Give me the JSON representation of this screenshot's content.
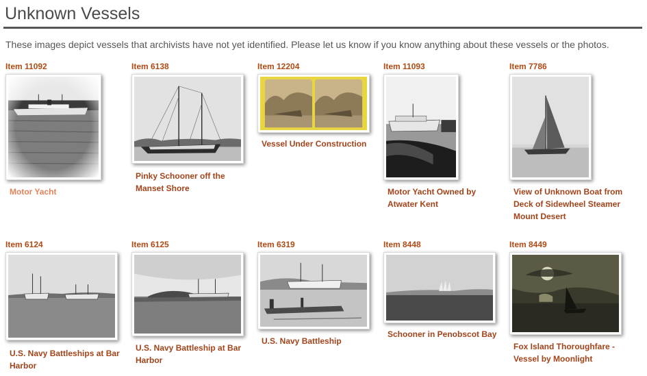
{
  "page": {
    "title": "Unknown Vessels",
    "intro": "These images depict vessels that archivists have not yet identified. Please let us know if you know anything about these vessels or the photos."
  },
  "colors": {
    "link": "#a3431a",
    "link_hover": "#e2825a",
    "rule": "#555555"
  },
  "items": [
    {
      "id": "Item 11092",
      "caption": "Motor Yacht",
      "image": "motor-yacht-photo"
    },
    {
      "id": "Item 6138",
      "caption": "Pinky Schooner off the Manset Shore",
      "image": "pinky-schooner-photo"
    },
    {
      "id": "Item 12204",
      "caption": "Vessel Under Construction",
      "image": "stereoview-card-photo"
    },
    {
      "id": "Item 11093",
      "caption": "Motor Yacht Owned by Atwater Kent",
      "image": "motor-yacht-kent-photo"
    },
    {
      "id": "Item 7786",
      "caption": "View of Unknown Boat from Deck of Sidewheel Steamer Mount Desert",
      "image": "sailboat-photo"
    },
    {
      "id": "Item 6124",
      "caption": "U.S. Navy Battleships at Bar Harbor",
      "image": "battleships-photo"
    },
    {
      "id": "Item 6125",
      "caption": "U.S. Navy Battleship at Bar Harbor",
      "image": "battleship-harbor-photo"
    },
    {
      "id": "Item 6319",
      "caption": "U.S. Navy Battleship",
      "image": "battleship-dock-photo"
    },
    {
      "id": "Item 8448",
      "caption": "Schooner in Penobscot Bay",
      "image": "schooner-bay-photo"
    },
    {
      "id": "Item 8449",
      "caption": "Fox Island Thoroughfare - Vessel by Moonlight",
      "image": "moonlight-vessel-photo"
    }
  ]
}
